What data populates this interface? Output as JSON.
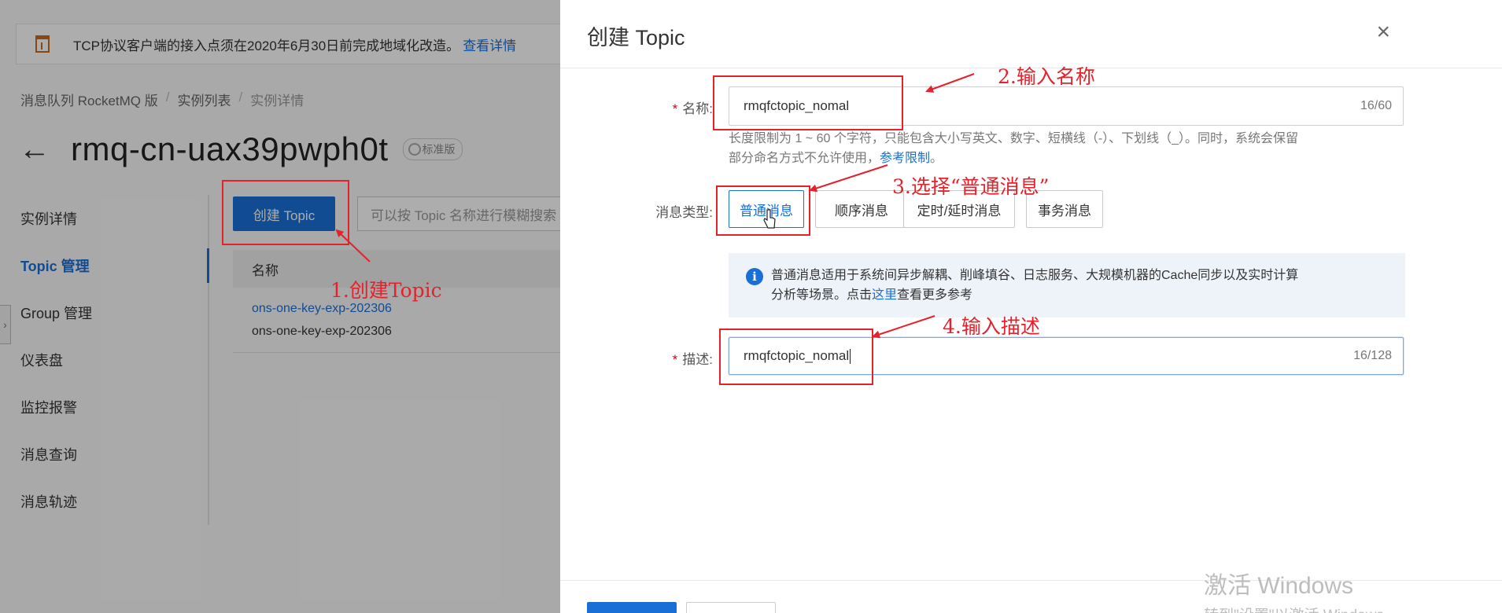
{
  "background": {
    "notice": {
      "text": "TCP协议客户端的接入点须在2020年6月30日前完成地域化改造。",
      "link": "查看详情",
      "icon": "calendar-icon"
    },
    "breadcrumb": [
      "消息队列 RocketMQ 版",
      "实例列表",
      "实例详情"
    ],
    "breadcrumb_sep": "/",
    "instance_title": "rmq-cn-uax39pwph0t",
    "edition_badge": "标准版",
    "sidebar": [
      {
        "label": "实例详情",
        "active": false
      },
      {
        "label": "Topic 管理",
        "active": true
      },
      {
        "label": "Group 管理",
        "active": false
      },
      {
        "label": "仪表盘",
        "active": false
      },
      {
        "label": "监控报警",
        "active": false
      },
      {
        "label": "消息查询",
        "active": false
      },
      {
        "label": "消息轨迹",
        "active": false
      }
    ],
    "create_button": "创建 Topic",
    "search_placeholder": "可以按 Topic 名称进行模糊搜索",
    "table_header": "名称",
    "rows": [
      "ons-one-key-exp-202306",
      "ons-one-key-exp-202306"
    ]
  },
  "drawer": {
    "title": "创建 Topic",
    "close_icon": "×",
    "name_label": "名称:",
    "required_mark": "*",
    "name_value": "rmqfctopic_nomal",
    "name_counter": "16/60",
    "hint_line1": "长度限制为 1 ~ 60 个字符，只能包含大小写英文、数字、短横线（-）、下划线（_）。同时，系统会保留",
    "hint_line2": "部分命名方式不允许使用，",
    "hint_link": "参考限制",
    "hint_end": "。",
    "type_label": "消息类型:",
    "types": [
      "普通消息",
      "顺序消息",
      "定时/延时消息",
      "事务消息"
    ],
    "selected_type": "普通消息",
    "info_line1": "普通消息适用于系统间异步解耦、削峰填谷、日志服务、大规模机器的Cache同步以及实时计算",
    "info_line2_pre": "分析等场景。点击",
    "info_link": "这里",
    "info_line2_post": "查看更多参考",
    "desc_label": "描述:",
    "desc_value": "rmqfctopic_nomal",
    "desc_counter": "16/128"
  },
  "watermark": {
    "line1": "激活 Windows",
    "line2": "转到\"设置\"以激活 Windows。"
  },
  "annotations": {
    "step1": "1.创建Topic",
    "step2": "2.输入名称",
    "step3": "3.选择“普通消息”",
    "step4": "4.输入描述",
    "color": "#e4222b"
  },
  "colors": {
    "primary": "#1a6fd6",
    "annotation": "#e4222b",
    "required": "#d0021b"
  }
}
